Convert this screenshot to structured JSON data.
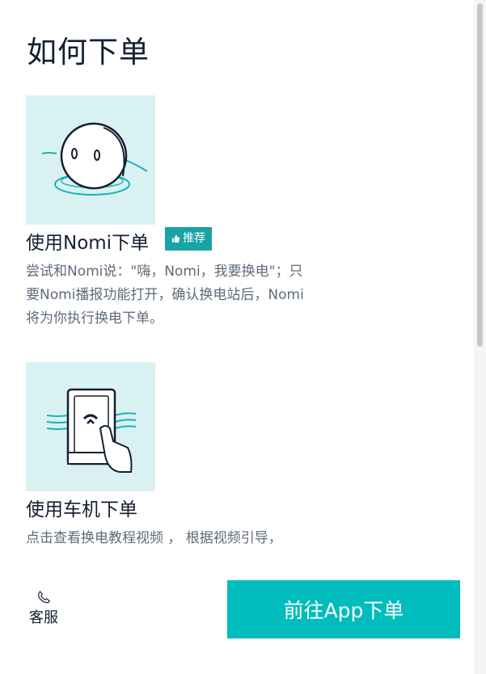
{
  "page": {
    "title": "如何下单"
  },
  "methods": [
    {
      "title": "使用Nomi下单",
      "badge": "推荐",
      "description": "尝试和Nomi说：\"嗨，Nomi，我要换电\"；只要Nomi播报功能打开，确认换电站后，Nomi将为你执行换电下单。",
      "illustration_icon": "nomi-robot-icon"
    },
    {
      "title": "使用车机下单",
      "description": "点击查看换电教程视频 ， 根据视频引导，",
      "illustration_icon": "car-screen-touch-icon"
    }
  ],
  "footer": {
    "service_label": "客服",
    "service_icon": "phone-icon",
    "cta_label": "前往App下单"
  },
  "colors": {
    "accent": "#00bcbc",
    "badge": "#1aa3a3",
    "illustration_bg": "#daf1f2",
    "text_primary": "#141f33",
    "text_secondary": "#5f6b7a"
  }
}
